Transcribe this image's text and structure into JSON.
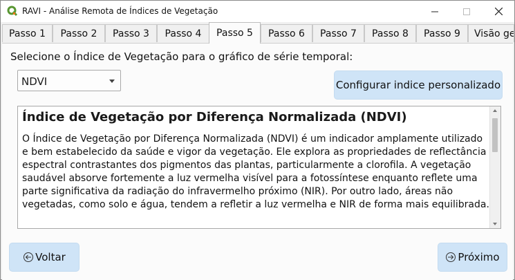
{
  "window": {
    "title": "RAVI - Análise Remota de Índices de Vegetação"
  },
  "tabs": [
    {
      "label": "Passo 1"
    },
    {
      "label": "Passo 2"
    },
    {
      "label": "Passo 3"
    },
    {
      "label": "Passo 4"
    },
    {
      "label": "Passo 5"
    },
    {
      "label": "Passo 6"
    },
    {
      "label": "Passo 7"
    },
    {
      "label": "Passo 8"
    },
    {
      "label": "Passo 9"
    },
    {
      "label": "Visão ge"
    }
  ],
  "active_tab": "Passo 5",
  "main": {
    "prompt": "Selecione o Índice de Vegetação para o gráfico de série temporal:",
    "index_select": {
      "value": "NDVI"
    },
    "custom_index_button": "Configurar indice personalizado",
    "description": {
      "title": "Índice de Vegetação por Diferença Normalizada (NDVI)",
      "body": "O Índice de Vegetação por Diferença Normalizada (NDVI) é um indicador amplamente utilizado e bem estabelecido da saúde e vigor da vegetação. Ele explora as propriedades de reflectância espectral contrastantes dos pigmentos das plantas, particularmente a clorofila. A vegetação saudável absorve fortemente a luz vermelha visível para a fotossíntese enquanto reflete uma parte significativa da radiação do infravermelho próximo (NIR). Por outro lado, áreas não vegetadas, como solo e água, tendem a refletir a luz vermelha e NIR de forma mais equilibrada."
    }
  },
  "footer": {
    "back_label": "Voltar",
    "next_label": "Próximo"
  },
  "icons": {
    "app": "qgis-icon",
    "back": "arrow-left-circle-icon",
    "next": "arrow-right-circle-icon"
  },
  "colors": {
    "button_bg": "#cfe4f7",
    "qgis_green": "#589632",
    "qgis_yellow": "#ee7913"
  }
}
